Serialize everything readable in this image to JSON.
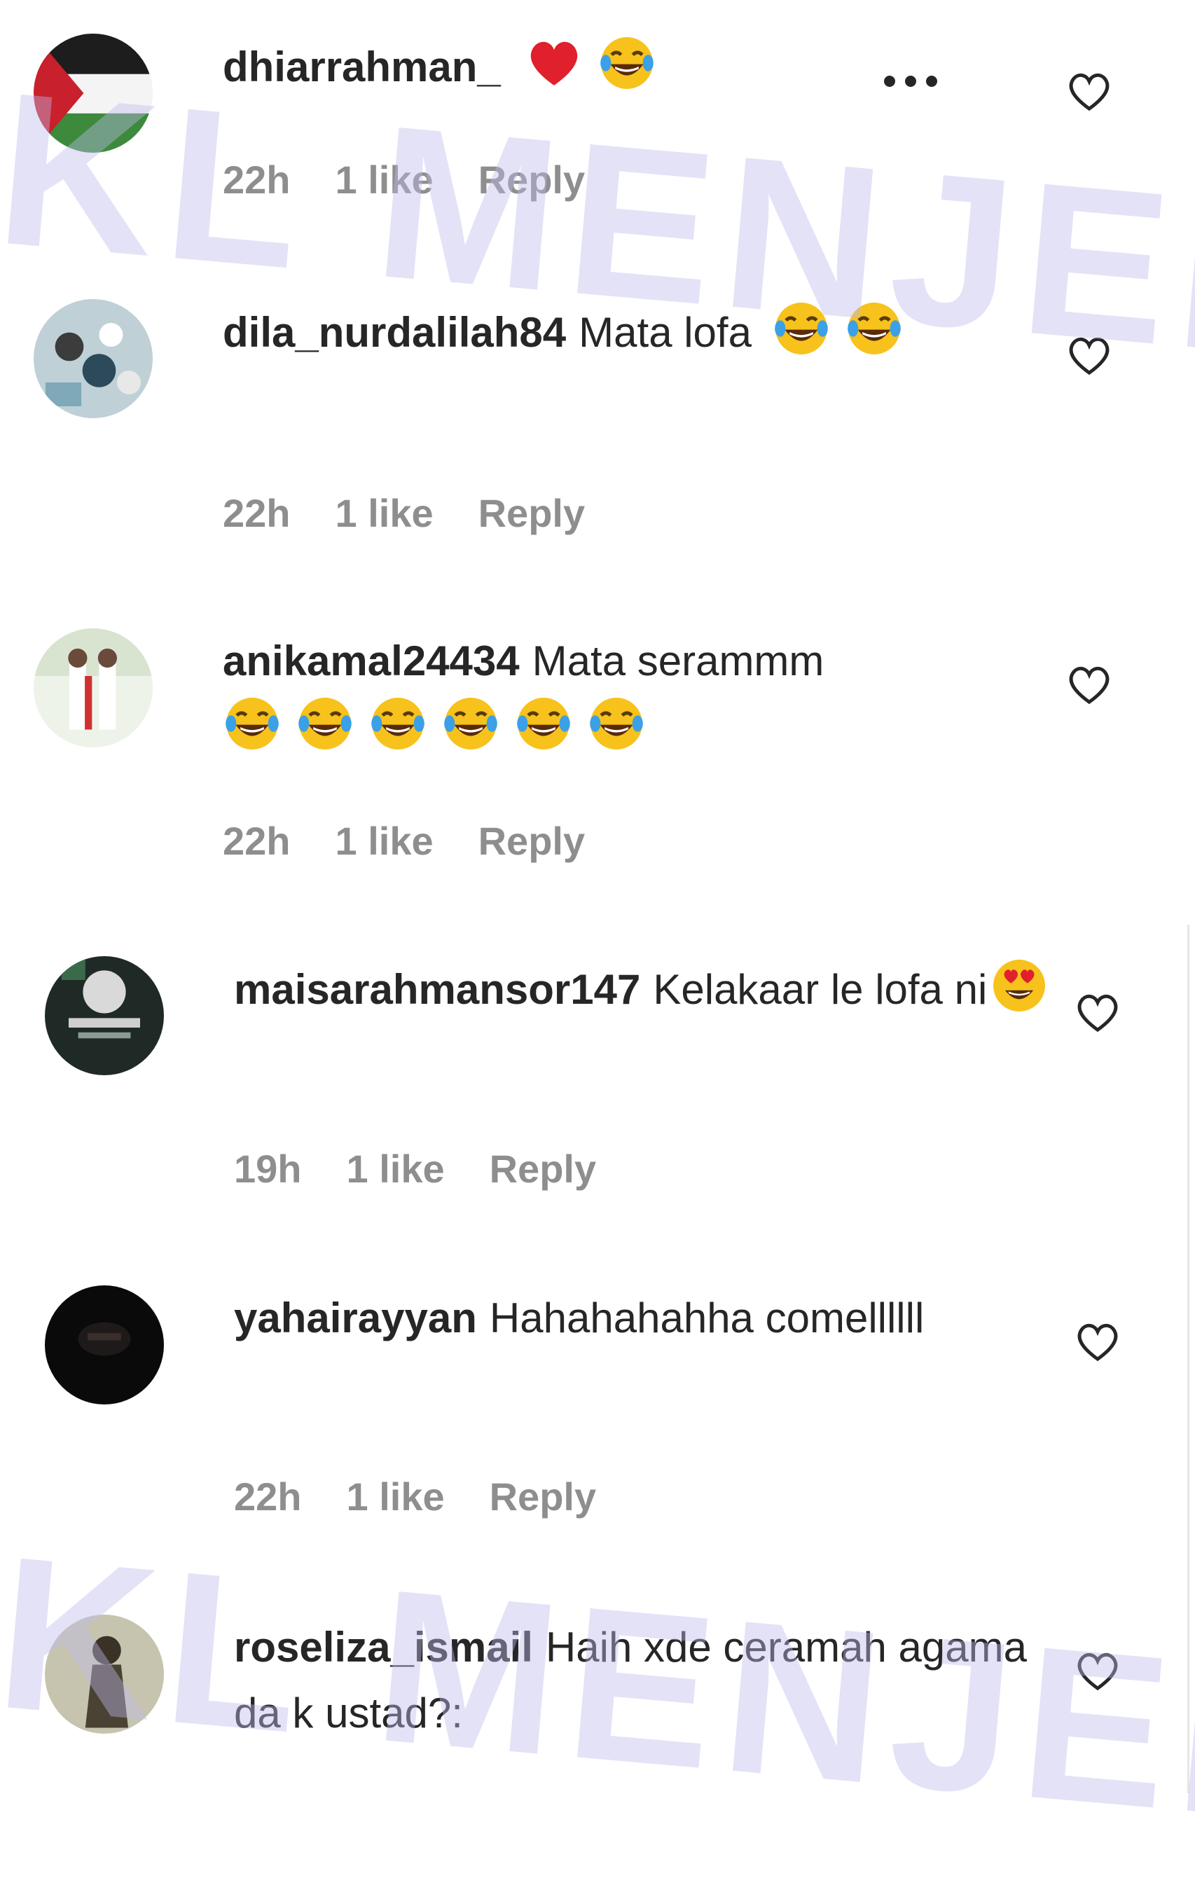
{
  "watermark": "KL MENJERIT",
  "more_label": "...",
  "comments": [
    {
      "username": "dhiarrahman_",
      "text": "",
      "emojis": [
        "heart",
        "laugh"
      ],
      "time": "22h",
      "likes": "1 like",
      "reply": "Reply"
    },
    {
      "username": "dila_nurdalilah84",
      "text": "Mata lofa",
      "emojis": [
        "laugh",
        "laugh"
      ],
      "time": "22h",
      "likes": "1 like",
      "reply": "Reply"
    },
    {
      "username": "anikamal24434",
      "text": "Mata serammm",
      "emojis": [
        "laugh",
        "laugh",
        "laugh",
        "laugh",
        "laugh",
        "laugh"
      ],
      "time": "22h",
      "likes": "1 like",
      "reply": "Reply"
    },
    {
      "username": "maisarahmansor147",
      "text": "Kelakaar le lofa ni",
      "emojis": [
        "heart-eyes"
      ],
      "time": "19h",
      "likes": "1 like",
      "reply": "Reply"
    },
    {
      "username": "yahairayyan",
      "text": "Hahahahahha comellllll",
      "emojis": [],
      "time": "22h",
      "likes": "1 like",
      "reply": "Reply"
    },
    {
      "username": "roseliza_ismail",
      "text": "Haih xde ceramah agama da k ustad?:",
      "emojis": [],
      "time": "",
      "likes": "",
      "reply": ""
    }
  ],
  "colors": {
    "text": "#262626",
    "meta": "#8e8e8e",
    "watermark": "#bebaeb",
    "heart": "#e0202c",
    "emoji_face": "#f7c21b"
  }
}
